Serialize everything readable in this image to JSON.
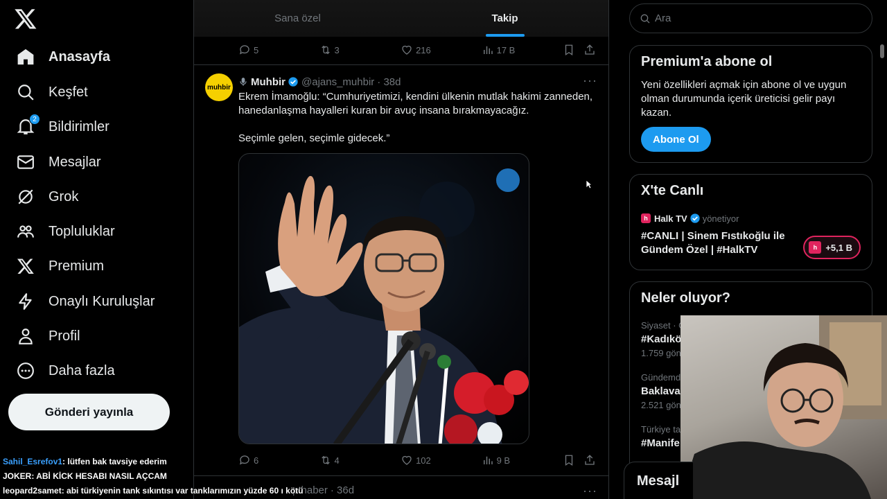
{
  "sidebar": {
    "items": [
      {
        "label": "Anasayfa",
        "icon": "home-icon"
      },
      {
        "label": "Keşfet",
        "icon": "search-icon"
      },
      {
        "label": "Bildirimler",
        "icon": "bell-icon",
        "badge": "2"
      },
      {
        "label": "Mesajlar",
        "icon": "mail-icon"
      },
      {
        "label": "Grok",
        "icon": "grok-icon"
      },
      {
        "label": "Topluluklar",
        "icon": "communities-icon"
      },
      {
        "label": "Premium",
        "icon": "x-logo-icon"
      },
      {
        "label": "Onaylı Kuruluşlar",
        "icon": "lightning-icon"
      },
      {
        "label": "Profil",
        "icon": "person-icon"
      },
      {
        "label": "Daha fazla",
        "icon": "more-circle-icon"
      }
    ],
    "post_button": "Gönderi yayınla"
  },
  "tabs": [
    {
      "label": "Sana özel",
      "active": false
    },
    {
      "label": "Takip",
      "active": true
    }
  ],
  "prev_tweet_actions": {
    "replies": "5",
    "reposts": "3",
    "likes": "216",
    "views": "17 B"
  },
  "tweet": {
    "avatar_text": "muhbir",
    "name": "Muhbir",
    "handle": "@ajans_muhbir",
    "time": "· 38d",
    "text_p1": "Ekrem İmamoğlu: “Cumhuriyetimizi, kendini ülkenin mutlak hakimi zanneden, hanedanlaşma hayalleri kuran bir avuç insana bırakmayacağız.",
    "text_p2": "Seçimle gelen, seçimle gidecek.”",
    "actions": {
      "replies": "6",
      "reposts": "4",
      "likes": "102",
      "views": "9 B"
    }
  },
  "next_tweet": {
    "handle_fragment": "pthaber",
    "time": "· 36d"
  },
  "right": {
    "search_placeholder": "Ara",
    "premium": {
      "title": "Premium'a abone ol",
      "desc": "Yeni özellikleri açmak için abone ol ve uygun olman durumunda içerik üreticisi gelir payı kazan.",
      "button": "Abone Ol"
    },
    "live": {
      "title": "X'te Canlı",
      "host": "Halk TV",
      "host_suffix": "yönetiyor",
      "stream_title": "#CANLI | Sinem Fıstıkoğlu ile Gündem Özel | #HalkTV",
      "viewers": "+5,1 B"
    },
    "trends": {
      "title": "Neler oluyor?",
      "items": [
        {
          "meta": "Siyaset · G",
          "title": "#Kadıkö",
          "count": "1.759 gön"
        },
        {
          "meta": "Gündemde",
          "title": "Baklava",
          "count": "2.521 gön"
        },
        {
          "meta": "Türkiye ta",
          "title": "#Manife",
          "count": ""
        }
      ]
    },
    "messages": "Mesajl"
  },
  "chat": [
    {
      "user": "Sahil_Esrefov1",
      "msg": ": lütfen bak tavsiye ederim"
    },
    {
      "user": "JOKER",
      "msg": ": ABİ KİCK HESABI NASIL AÇCAM"
    },
    {
      "user": "leopard2samet",
      "msg": ": abi türkiyenin tank sıkıntısı var tanklarımızın yüzde 60 ı kötü"
    }
  ],
  "colors": {
    "accent": "#1d9bf0",
    "live": "#e0245e",
    "avatar_bg": "#f5d000"
  }
}
